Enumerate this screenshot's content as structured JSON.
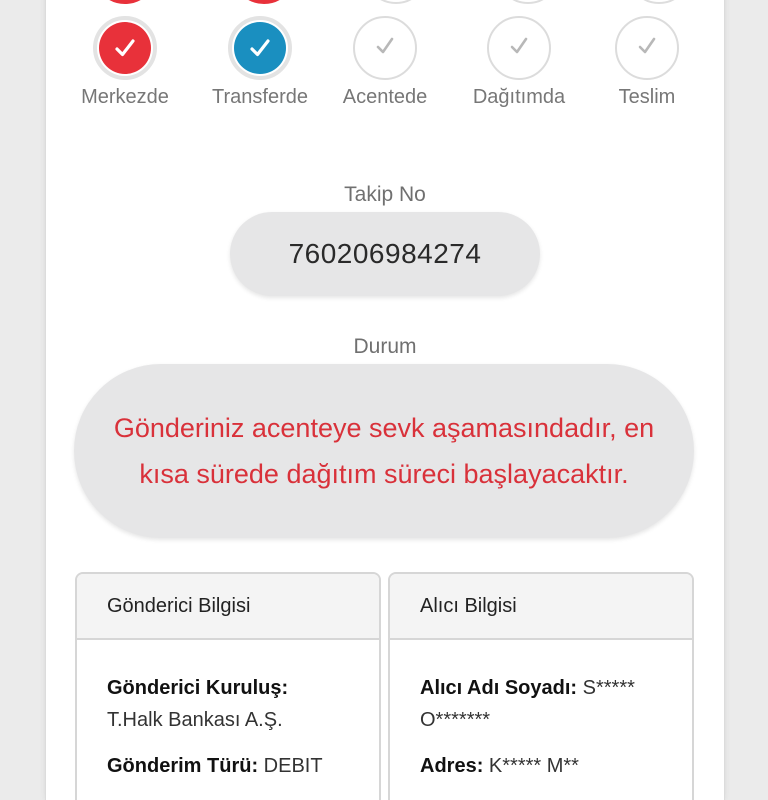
{
  "steps": [
    {
      "label": "Merkezde",
      "state": "done",
      "color": "#e8313a"
    },
    {
      "label": "Transferde",
      "state": "done",
      "color": "#1a8fc0"
    },
    {
      "label": "Acentede",
      "state": "pending",
      "color": "#bdbdbd"
    },
    {
      "label": "Dağıtımda",
      "state": "pending",
      "color": "#bdbdbd"
    },
    {
      "label": "Teslim",
      "state": "pending",
      "color": "#bdbdbd"
    }
  ],
  "tracking": {
    "label": "Takip No",
    "number": "760206984274"
  },
  "status": {
    "label": "Durum",
    "message": "Gönderiniz acenteye sevk aşamasındadır, en kısa sürede dağıtım süreci başlayacaktır."
  },
  "sender": {
    "title": "Gönderici Bilgisi",
    "institution_label": "Gönderici Kuruluş:",
    "institution_value": "T.Halk Bankası A.Ş.",
    "type_label": "Gönderim Türü:",
    "type_value": "DEBIT"
  },
  "receiver": {
    "title": "Alıcı Bilgisi",
    "name_label": "Alıcı Adı Soyadı:",
    "name_value": "S***** O*******",
    "address_label": "Adres:",
    "address_value": "K***** M**"
  },
  "colors": {
    "accent_red": "#d9313a",
    "accent_blue": "#1a8fc0"
  }
}
